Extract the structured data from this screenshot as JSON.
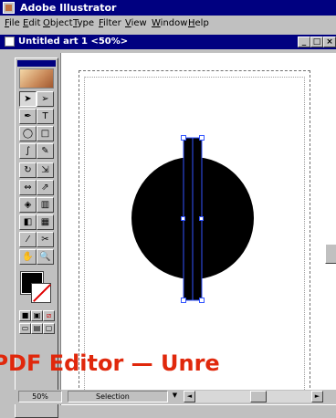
{
  "app": {
    "title": "Adobe Illustrator"
  },
  "menu": [
    "File",
    "Edit",
    "Object",
    "Type",
    "Filter",
    "View",
    "Window",
    "Help"
  ],
  "document": {
    "title": "Untitled art 1 <50%>",
    "controls": {
      "minimize": "_",
      "restore": "□",
      "close": "×"
    }
  },
  "tools": [
    [
      "selection-arrow-icon",
      "direct-selection-icon"
    ],
    [
      "pen-icon",
      "type-icon"
    ],
    [
      "ellipse-icon",
      "rectangle-icon"
    ],
    [
      "paintbrush-icon",
      "pencil-icon"
    ],
    [
      "rotate-icon",
      "scale-icon"
    ],
    [
      "reflect-icon",
      "shear-icon"
    ],
    [
      "blend-icon",
      "graph-icon"
    ],
    [
      "gradient-icon",
      "gradient-mesh-icon"
    ],
    [
      "eyedropper-icon",
      "scissors-icon"
    ],
    [
      "hand-icon",
      "zoom-icon"
    ]
  ],
  "tool_glyphs": [
    [
      "➤",
      "➢"
    ],
    [
      "✒",
      "T"
    ],
    [
      "◯",
      "□"
    ],
    [
      "∫",
      "✎"
    ],
    [
      "↻",
      "⇲"
    ],
    [
      "⇔",
      "⇗"
    ],
    [
      "◈",
      "▥"
    ],
    [
      "◧",
      "▦"
    ],
    [
      "⁄",
      "✂"
    ],
    [
      "✋",
      "🔍"
    ]
  ],
  "colors": {
    "fill": "#000000",
    "stroke": "none",
    "modes": [
      "color",
      "gradient",
      "none"
    ],
    "modes_glyphs": [
      "■",
      "▣",
      "⧄"
    ],
    "views": [
      "standard-screen",
      "full-screen-menu",
      "full-screen"
    ],
    "views_glyphs": [
      "▭",
      "▤",
      "▢"
    ]
  },
  "status": {
    "zoom": "50%",
    "tool": "Selection",
    "dropdown_arrow": "▼",
    "scroll_glyphs": {
      "left": "◄",
      "right": "►"
    }
  },
  "watermark": "n PDF Editor — Unre"
}
